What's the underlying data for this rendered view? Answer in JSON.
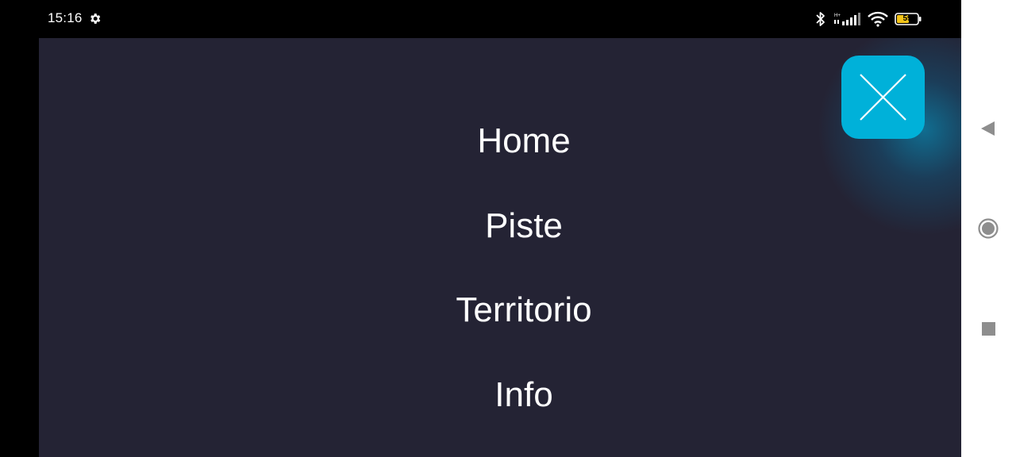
{
  "status_bar": {
    "time": "15:16",
    "battery_level": "59",
    "icons": [
      "settings-icon",
      "bluetooth-icon",
      "signal-icon",
      "wifi-icon",
      "battery-icon"
    ]
  },
  "menu": {
    "items": [
      {
        "label": "Home"
      },
      {
        "label": "Piste"
      },
      {
        "label": "Territorio"
      },
      {
        "label": "Info"
      }
    ],
    "close_icon": "close-icon"
  },
  "colors": {
    "background": "#242334",
    "accent": "#00b1d9",
    "text": "#ffffff",
    "battery": "#f5c518"
  },
  "navigation_bar": {
    "icons": [
      "back-icon",
      "home-icon",
      "recents-icon"
    ]
  }
}
